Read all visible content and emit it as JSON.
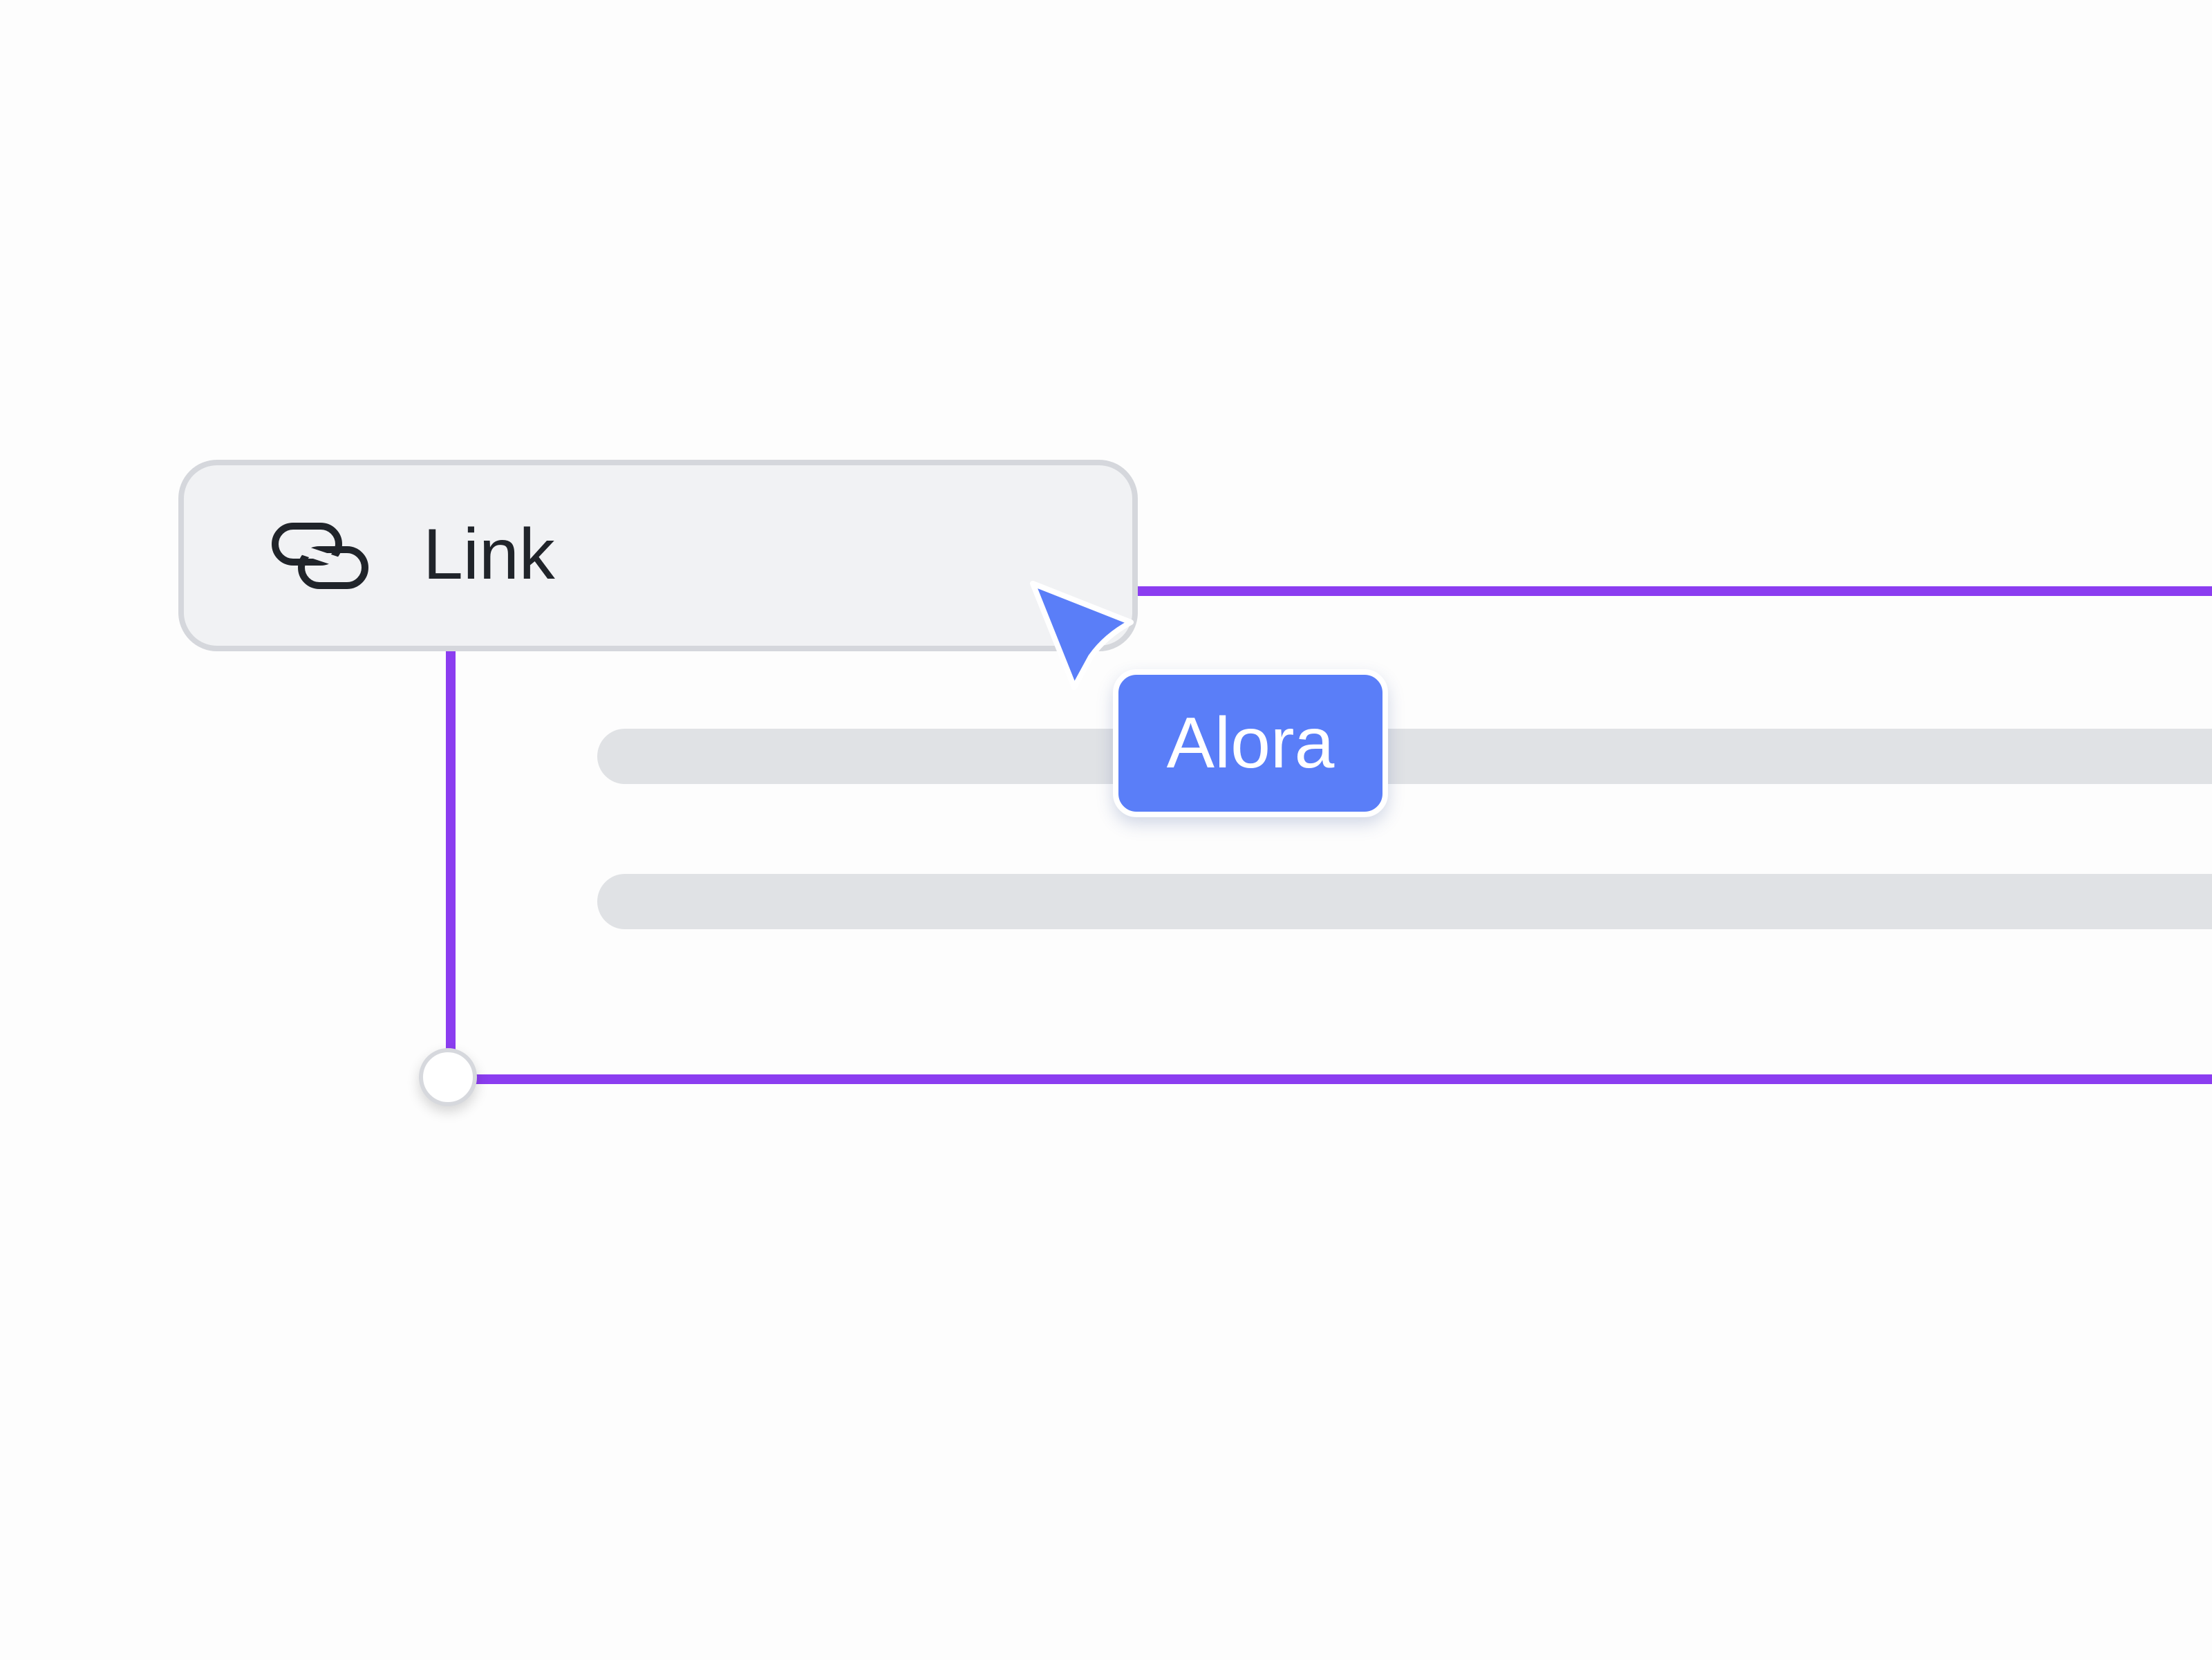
{
  "editor": {
    "selected_block": {
      "label": "Link",
      "icon": "link-icon"
    },
    "collaborator": {
      "name": "Alora",
      "color": "#5a7ef8",
      "cursor_icon": "cursor-arrow-icon"
    },
    "selection_color": "#8b3df0",
    "placeholder_color": "#e0e2e5"
  }
}
